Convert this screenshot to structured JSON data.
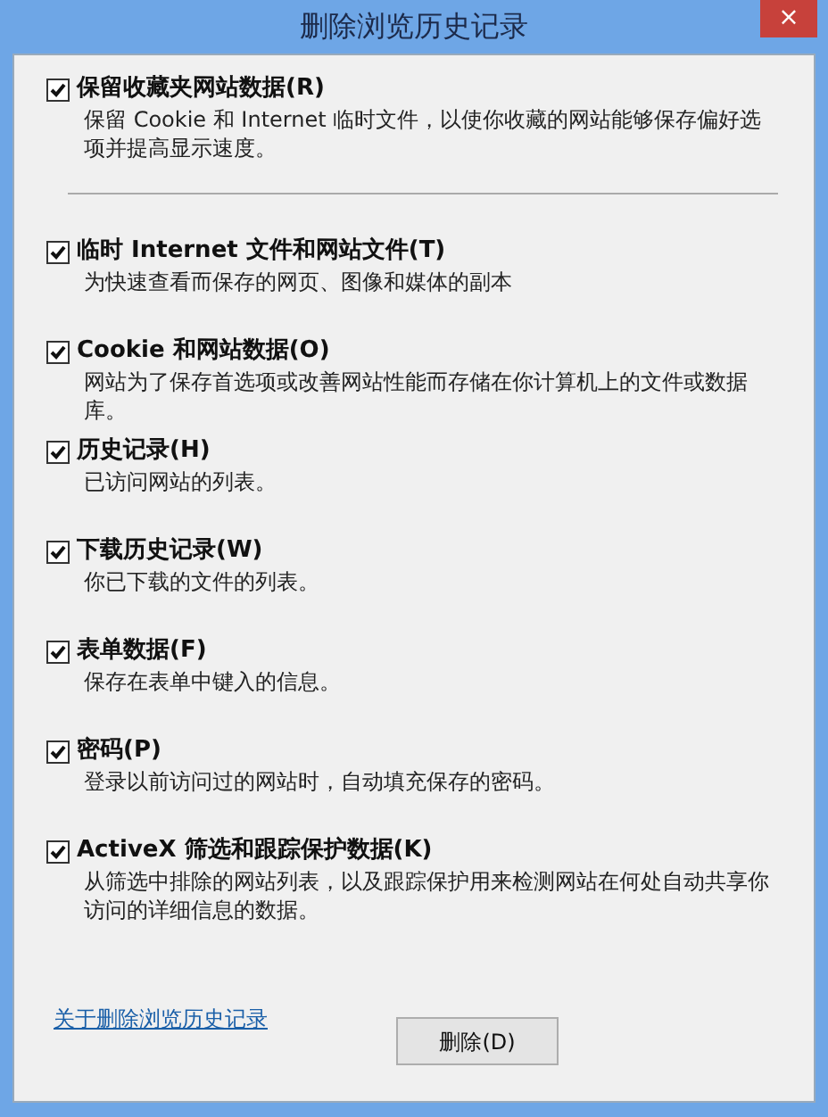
{
  "window": {
    "title": "删除浏览历史记录",
    "close": "×"
  },
  "options": [
    {
      "label": "保留收藏夹网站数据(R)",
      "description": "保留 Cookie 和 Internet 临时文件，以使你收藏的网站能够保存偏好选项并提高显示速度。",
      "checked": true
    },
    {
      "label": "临时 Internet 文件和网站文件(T)",
      "description": "为快速查看而保存的网页、图像和媒体的副本",
      "checked": true
    },
    {
      "label": "Cookie 和网站数据(O)",
      "description": "网站为了保存首选项或改善网站性能而存储在你计算机上的文件或数据库。",
      "checked": true
    },
    {
      "label": "历史记录(H)",
      "description": "已访问网站的列表。",
      "checked": true
    },
    {
      "label": "下载历史记录(W)",
      "description": "你已下载的文件的列表。",
      "checked": true
    },
    {
      "label": "表单数据(F)",
      "description": "保存在表单中键入的信息。",
      "checked": true
    },
    {
      "label": "密码(P)",
      "description": "登录以前访问过的网站时，自动填充保存的密码。",
      "checked": true
    },
    {
      "label": "ActiveX 筛选和跟踪保护数据(K)",
      "description": "从筛选中排除的网站列表，以及跟踪保护用来检测网站在何处自动共享你访问的详细信息的数据。",
      "checked": true
    }
  ],
  "footer": {
    "link": "关于删除浏览历史记录",
    "delete_button": "删除(D)"
  }
}
